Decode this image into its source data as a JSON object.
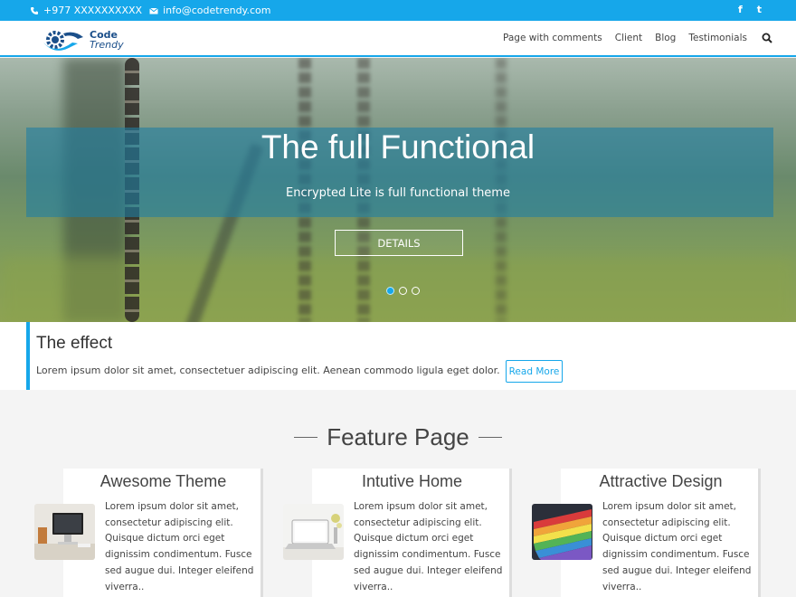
{
  "topbar": {
    "phone": "+977 XXXXXXXXXX",
    "email": "info@codetrendy.com",
    "social": [
      {
        "icon": "facebook-icon",
        "glyph": "f"
      },
      {
        "icon": "twitter-icon",
        "glyph": "t"
      }
    ]
  },
  "header": {
    "logo_line1": "Code",
    "logo_line2": "Trendy",
    "nav": [
      "Page with comments",
      "Client",
      "Blog",
      "Testimonials"
    ]
  },
  "hero": {
    "title": "The full Functional",
    "subtitle": "Encrypted Lite is full functional theme",
    "button": "DETAILS",
    "slides": 3,
    "active_slide": 1
  },
  "effect": {
    "title": "The effect",
    "text": "Lorem ipsum dolor sit amet, consectetuer adipiscing elit. Aenean commodo ligula eget dolor.",
    "button": "Read More"
  },
  "features": {
    "title": "Feature Page",
    "items": [
      {
        "title": "Awesome Theme",
        "text": "Lorem ipsum dolor sit amet, consectetur adipiscing elit. Quisque dictum orci eget dignissim condimentum. Fusce sed augue dui. Integer eleifend viverra.."
      },
      {
        "title": "Intutive Home",
        "text": "Lorem ipsum dolor sit amet, consectetur adipiscing elit. Quisque dictum orci eget dignissim condimentum. Fusce sed augue dui. Integer eleifend viverra.."
      },
      {
        "title": "Attractive Design",
        "text": "Lorem ipsum dolor sit amet, consectetur adipiscing elit. Quisque dictum orci eget dignissim condimentum. Fusce sed augue dui. Integer eleifend viverra.."
      }
    ]
  },
  "colors": {
    "accent": "#16a7ea",
    "logo": "#1b4f8a"
  }
}
